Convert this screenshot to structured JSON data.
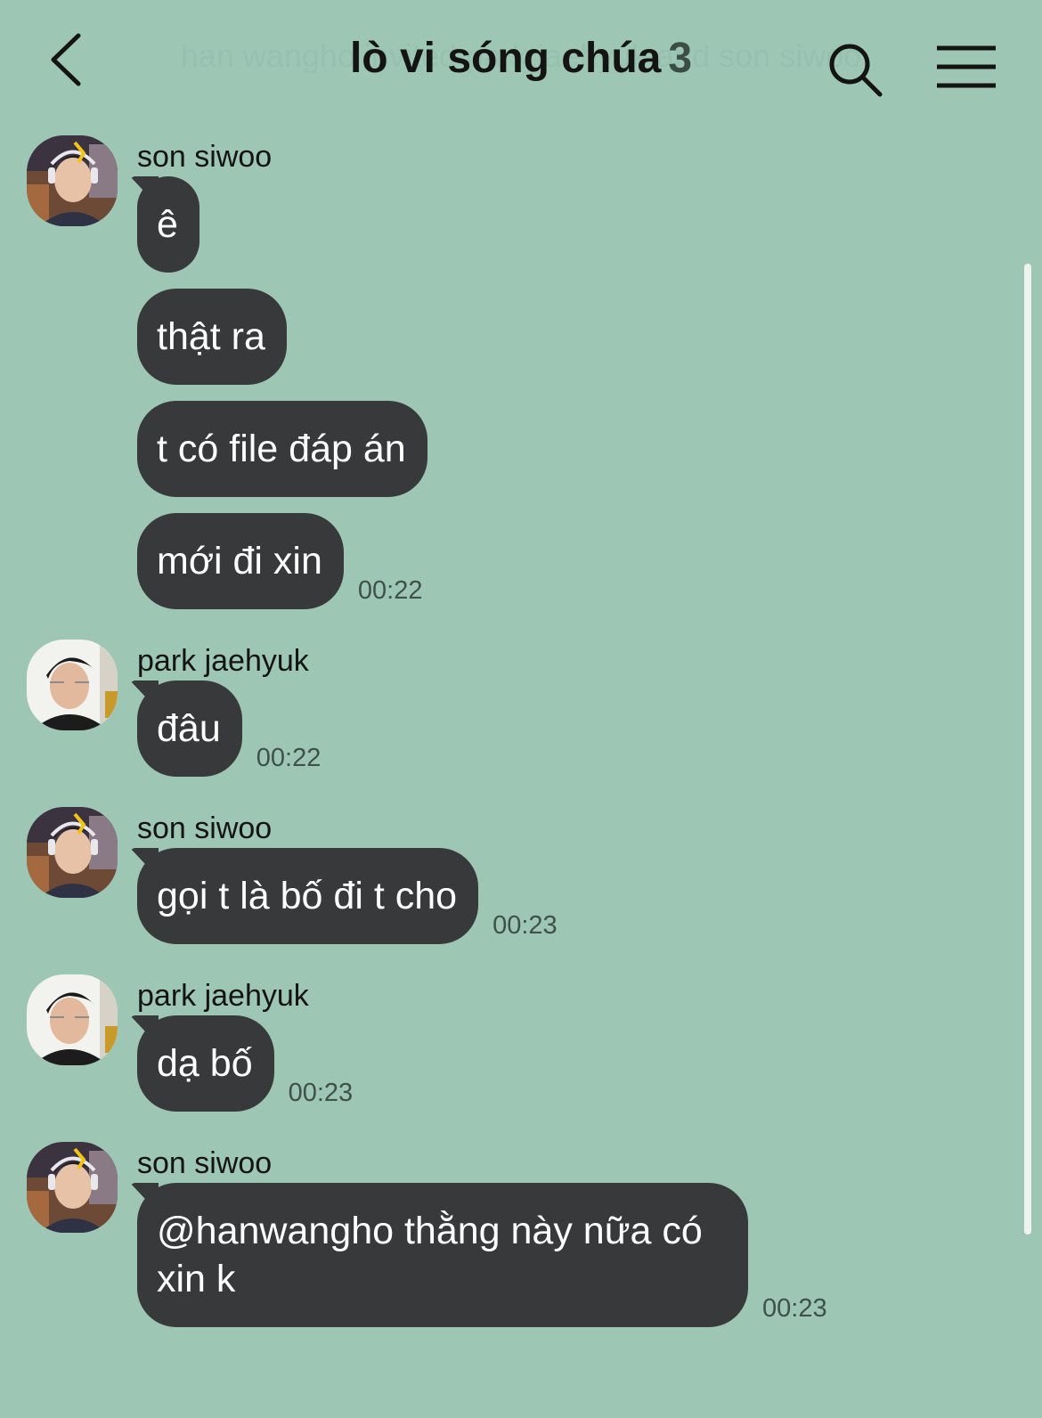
{
  "header": {
    "title": "lò vi sóng chúa",
    "member_count": "3",
    "ghost_text": "han wangho invited park jaehyuk and son siwoo"
  },
  "colors": {
    "background": "#9dc6b5",
    "bubble": "#38393b",
    "bubble_text": "#ffffff"
  },
  "messages": [
    {
      "sender": "son siwoo",
      "avatar": "avatar-son-siwoo",
      "bubbles": [
        "ê",
        "thật ra",
        "t có file đáp án",
        "mới đi xin"
      ],
      "time": "00:22"
    },
    {
      "sender": "park jaehyuk",
      "avatar": "avatar-park-jaehyuk",
      "bubbles": [
        "đâu"
      ],
      "time": "00:22"
    },
    {
      "sender": "son siwoo",
      "avatar": "avatar-son-siwoo",
      "bubbles": [
        "gọi t là bố đi t cho"
      ],
      "time": "00:23"
    },
    {
      "sender": "park jaehyuk",
      "avatar": "avatar-park-jaehyuk",
      "bubbles": [
        "dạ bố"
      ],
      "time": "00:23"
    },
    {
      "sender": "son siwoo",
      "avatar": "avatar-son-siwoo",
      "bubbles": [
        "@hanwangho thằng này nữa có xin k"
      ],
      "time": "00:23"
    }
  ]
}
